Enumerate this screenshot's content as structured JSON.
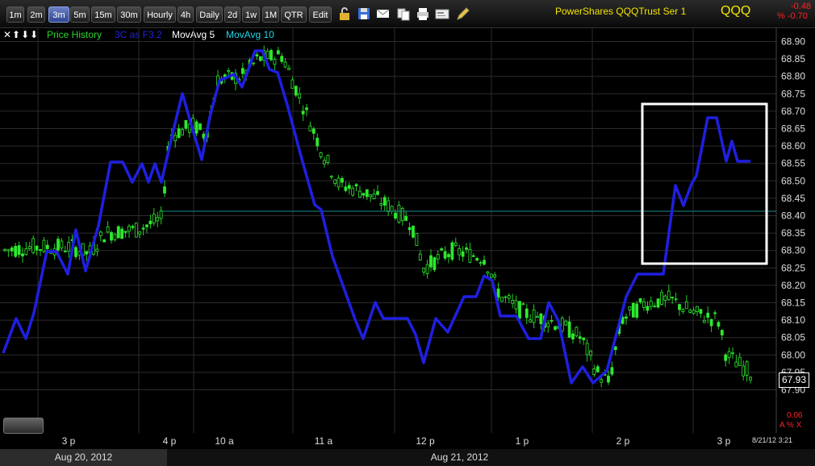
{
  "toolbar": {
    "timeframes": [
      {
        "label": "1m",
        "active": false
      },
      {
        "label": "2m",
        "active": false
      },
      {
        "label": "3m",
        "active": true
      },
      {
        "label": "5m",
        "active": false
      },
      {
        "label": "15m",
        "active": false
      },
      {
        "label": "30m",
        "active": false
      },
      {
        "label": "Hourly",
        "active": false
      },
      {
        "label": "4h",
        "active": false
      },
      {
        "label": "Daily",
        "active": false
      },
      {
        "label": "2d",
        "active": false
      },
      {
        "label": "1w",
        "active": false
      },
      {
        "label": "1M",
        "active": false
      },
      {
        "label": "QTR",
        "active": false
      },
      {
        "label": "Edit",
        "active": false
      }
    ],
    "icons": [
      "lock-icon",
      "save-icon",
      "mail-icon",
      "copy-icon",
      "print-icon",
      "card-icon",
      "pencil-icon"
    ]
  },
  "quote": {
    "name": "PowerShares QQQTrust Ser 1",
    "ticker": "QQQ",
    "change": "-0.48",
    "change_pct": "% -0.70"
  },
  "legend": {
    "controls": "✕⬆⬇⬇",
    "price": "Price History",
    "price_color": "#2bd62b",
    "indicator": "3C as F3.2",
    "indicator_color": "#2222dd",
    "ma5": "MovAvg 5",
    "ma10": "MovAvg 10",
    "ma10_color": "#1fd7e8"
  },
  "y_axis": [
    "68.90",
    "68.85",
    "68.80",
    "68.75",
    "68.70",
    "68.65",
    "68.60",
    "68.55",
    "68.50",
    "68.45",
    "68.40",
    "68.35",
    "68.30",
    "68.25",
    "68.20",
    "68.15",
    "68.10",
    "68.05",
    "68.00",
    "67.95",
    "67.90"
  ],
  "x_axis": [
    "3 p",
    "4 p",
    "10 a",
    "11 a",
    "12 p",
    "1 p",
    "2 p",
    "3 p"
  ],
  "dates": [
    "Aug 20, 2012",
    "Aug 21, 2012"
  ],
  "last_price": "67.93",
  "bottom_value": "0.06",
  "bottom_controls": "A  %  X",
  "timestamp": "8/21/12 3:21"
}
